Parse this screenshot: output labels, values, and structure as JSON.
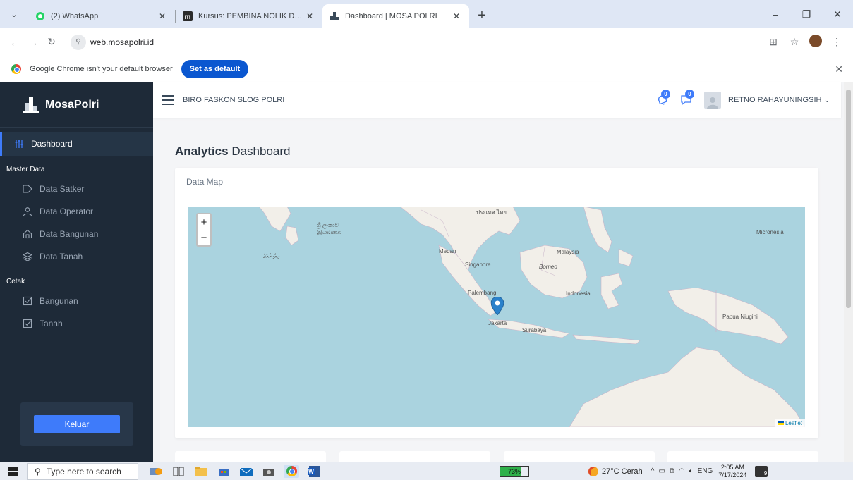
{
  "browser": {
    "tabs": [
      {
        "title": "(2) WhatsApp",
        "icon": "whatsapp-icon"
      },
      {
        "title": "Kursus: PEMBINA NOLIK DWI ANGGRAINI",
        "icon": "moodle-icon"
      },
      {
        "title": "Dashboard | MOSA POLRI",
        "icon": "mosa-icon"
      }
    ],
    "url": "web.mosapolri.id",
    "infobar_message": "Google Chrome isn't your default browser",
    "set_default_label": "Set as default"
  },
  "sidebar": {
    "brand": "MosaPolri",
    "active_item": "Dashboard",
    "sections": [
      {
        "heading": "Master Data",
        "items": [
          "Data Satker",
          "Data Operator",
          "Data Bangunan",
          "Data Tanah"
        ]
      },
      {
        "heading": "Cetak",
        "items": [
          "Bangunan",
          "Tanah"
        ]
      }
    ],
    "logout_label": "Keluar"
  },
  "header": {
    "org": "BIRO FASKON SLOG POLRI",
    "notification_count": "0",
    "message_count": "0",
    "user_name": "RETNO RAHAYUNINGSIH"
  },
  "page": {
    "title_bold": "Analytics",
    "title_rest": "Dashboard",
    "map_card_title": "Data Map"
  },
  "map": {
    "zoom_in": "+",
    "zoom_out": "−",
    "attribution": "Leaflet",
    "labels": {
      "thai": "ประเทศ ไทย",
      "srilanka": "ශ්‍රී ලංකාව இலங்கை",
      "maldives": "ދިވެހިރާއްޖެ",
      "medan": "Medan",
      "malaysia": "Malaysia",
      "singapore": "Singapore",
      "borneo": "Borneo",
      "palembang": "Palembang",
      "indonesia": "Indonesia",
      "jakarta": "Jakarta",
      "surabaya": "Surabaya",
      "micronesia": "Micronesia",
      "papua": "Papua Niugini"
    },
    "water_color": "#aad3df",
    "land_color": "#f2efe9",
    "marker_color": "#2a81cb"
  },
  "taskbar": {
    "search_placeholder": "Type here to search",
    "battery": "73%",
    "battery_level": 0.73,
    "weather": "27°C  Cerah",
    "language": "ENG",
    "time": "2:05 AM",
    "date": "7/17/2024",
    "notification_count": "9"
  },
  "colors": {
    "sidebar_bg": "#1e2a38",
    "accent": "#3e7bfa",
    "chrome_tab_bg": "#dfe7f5"
  }
}
